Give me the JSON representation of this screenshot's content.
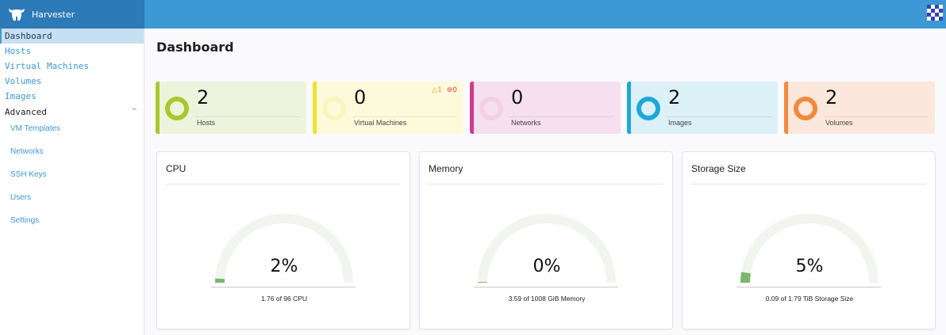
{
  "brand": {
    "name": "Harvester",
    "logo_icon": "harvester-cow-icon"
  },
  "sidebar": {
    "items": [
      {
        "label": "Dashboard",
        "active": true
      },
      {
        "label": "Hosts"
      },
      {
        "label": "Virtual Machines"
      },
      {
        "label": "Volumes"
      },
      {
        "label": "Images"
      }
    ],
    "advanced": {
      "label": "Advanced",
      "chevron": "^",
      "items": [
        {
          "label": "VM Templates"
        },
        {
          "label": "Networks"
        },
        {
          "label": "SSH Keys"
        },
        {
          "label": "Users"
        },
        {
          "label": "Settings"
        }
      ]
    }
  },
  "page": {
    "title": "Dashboard"
  },
  "stats": [
    {
      "count": "2",
      "label": "Hosts",
      "accent": "#a7c92b",
      "bg": "#eef3de",
      "ring": "#a7c92b"
    },
    {
      "count": "0",
      "label": "Virtual Machines",
      "accent": "#f0e12b",
      "bg": "#fdfadc",
      "ring": "#fbf4bd",
      "alerts": {
        "warning": "△1",
        "error": "⊜0"
      }
    },
    {
      "count": "0",
      "label": "Networks",
      "accent": "#d03a8a",
      "bg": "#f6dfee",
      "ring": "#f2d0e6"
    },
    {
      "count": "2",
      "label": "Images",
      "accent": "#1ea8d6",
      "bg": "#dcf0f8",
      "ring": "#1ea8d6"
    },
    {
      "count": "2",
      "label": "Volumes",
      "accent": "#f08a3e",
      "bg": "#fce7dc",
      "ring": "#f08a3e"
    }
  ],
  "gauges": [
    {
      "title": "CPU",
      "percent_label": "2%",
      "percent": 0.02,
      "subtitle": "1.76 of 96 CPU"
    },
    {
      "title": "Memory",
      "percent_label": "0%",
      "percent": 0.003,
      "subtitle": "3.59 of 1008 GiB Memory"
    },
    {
      "title": "Storage Size",
      "percent_label": "5%",
      "percent": 0.05,
      "subtitle": "0.09 of 1.79 TiB Storage Size"
    }
  ],
  "colors": {
    "header": "#3d98d3",
    "brand_bg": "#2d7ab8",
    "gauge_fill": "#7ab86b",
    "gauge_track": "#f2f4ef"
  }
}
